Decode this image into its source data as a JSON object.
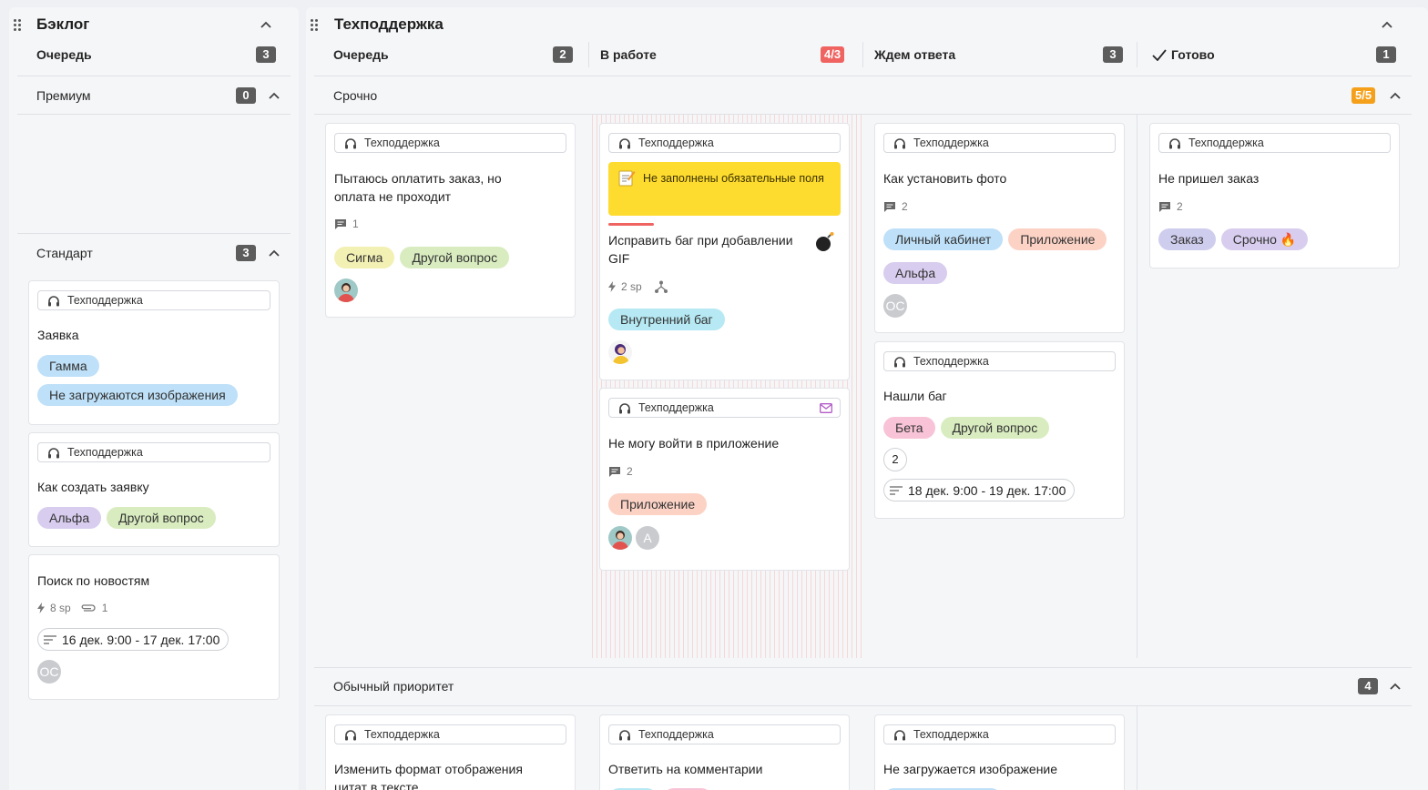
{
  "backlog": {
    "title": "Бэклог",
    "queue_column": {
      "label": "Очередь",
      "count": "3"
    },
    "groups": [
      {
        "label": "Премиум",
        "count": "0"
      },
      {
        "label": "Стандарт",
        "count": "3"
      }
    ],
    "cards": [
      {
        "queue": "Техподдержка",
        "title": "Заявка",
        "tags": [
          "Гамма",
          "Не загружаются изображения"
        ]
      },
      {
        "queue": "Техподдержка",
        "title": "Как создать заявку",
        "tags": [
          "Альфа",
          "Другой вопрос"
        ]
      },
      {
        "title": "Поиск по новостям",
        "sp": "8 sp",
        "attachments": "1",
        "dates": "16 дек. 9:00 - 17 дек. 17:00",
        "avatar": "ОС"
      }
    ]
  },
  "board": {
    "title": "Техподдержка",
    "columns": [
      {
        "label": "Очередь",
        "count": "2"
      },
      {
        "label": "В работе",
        "count": "4/3"
      },
      {
        "label": "Ждем ответа",
        "count": "3"
      },
      {
        "label": "Готово",
        "count": "1"
      }
    ],
    "groups": [
      {
        "label": "Срочно",
        "count": "5/5"
      },
      {
        "label": "Обычный приоритет",
        "count": "4"
      }
    ],
    "urgent_cards": [
      {
        "queue": "Техподдержка",
        "title": "Пытаюсь оплатить заказ, но оплата не проходит",
        "comments": "1",
        "tags": [
          "Сигма",
          "Другой вопрос"
        ]
      },
      {
        "queue": "Техподдержка",
        "warning": "Не заполнены обязательные поля",
        "title": "Исправить баг при добавлении GIF",
        "sp": "2 sp",
        "tags": [
          "Внутренний баг"
        ]
      },
      {
        "queue": "Техподдержка",
        "title": "Не могу войти в приложение",
        "comments": "2",
        "tags": [
          "Приложение"
        ],
        "avatar": "A"
      },
      {
        "queue": "Техподдержка",
        "title": "Как установить фото",
        "comments": "2",
        "tags": [
          "Личный кабинет",
          "Приложение",
          "Альфа"
        ],
        "avatar": "ОС"
      },
      {
        "queue": "Техподдержка",
        "title": "Нашли баг",
        "tags": [
          "Бета",
          "Другой вопрос"
        ],
        "number": "2",
        "dates": "18 дек. 9:00 - 19 дек. 17:00"
      },
      {
        "queue": "Техподдержка",
        "title": "Не пришел заказ",
        "comments": "2",
        "tags": [
          "Заказ",
          "Срочно 🔥"
        ]
      }
    ],
    "normal_cards": [
      {
        "queue": "Техподдержка",
        "title": "Изменить формат отображения цитат в тексте"
      },
      {
        "queue": "Техподдержка",
        "title": "Ответить на комментарии"
      },
      {
        "queue": "Техподдержка",
        "title": "Не загружается изображение"
      }
    ]
  },
  "colors": {
    "tag_yellow": "#f3f0b4",
    "tag_green": "#d9ecc0",
    "tag_blue": "#bee0f8",
    "tag_purple": "#d8cdee",
    "tag_cyan": "#b6e9f3",
    "tag_salmon": "#fcd2c5",
    "tag_pink": "#f8c3d6",
    "tag_lavender": "#cfcdee",
    "count_red": "#ef6461",
    "count_orange": "#f5a01a"
  }
}
